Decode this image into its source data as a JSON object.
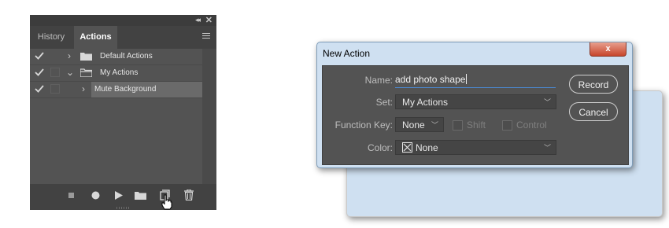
{
  "panel": {
    "tabs": [
      "History",
      "Actions"
    ],
    "active_tab": "Actions",
    "rows": [
      {
        "label": "Default Actions",
        "type": "set",
        "expanded": false,
        "checked": true,
        "dialog_toggle": true
      },
      {
        "label": "My Actions",
        "type": "set",
        "expanded": true,
        "checked": true,
        "dialog_toggle": false
      },
      {
        "label": "Mute Background",
        "type": "action",
        "expanded": false,
        "checked": true,
        "dialog_toggle": false,
        "selected": true
      }
    ],
    "bottom_icons": [
      "stop-icon",
      "record-icon",
      "play-icon",
      "new-set-icon",
      "new-action-icon",
      "delete-icon"
    ]
  },
  "dialog": {
    "title": "New Action",
    "close_label": "x",
    "name_label": "Name:",
    "name_value": "add photo shape",
    "set_label": "Set:",
    "set_value": "My Actions",
    "function_key_label": "Function Key:",
    "function_key_value": "None",
    "shift_label": "Shift",
    "control_label": "Control",
    "color_label": "Color:",
    "color_value": "None",
    "record_label": "Record",
    "cancel_label": "Cancel"
  }
}
